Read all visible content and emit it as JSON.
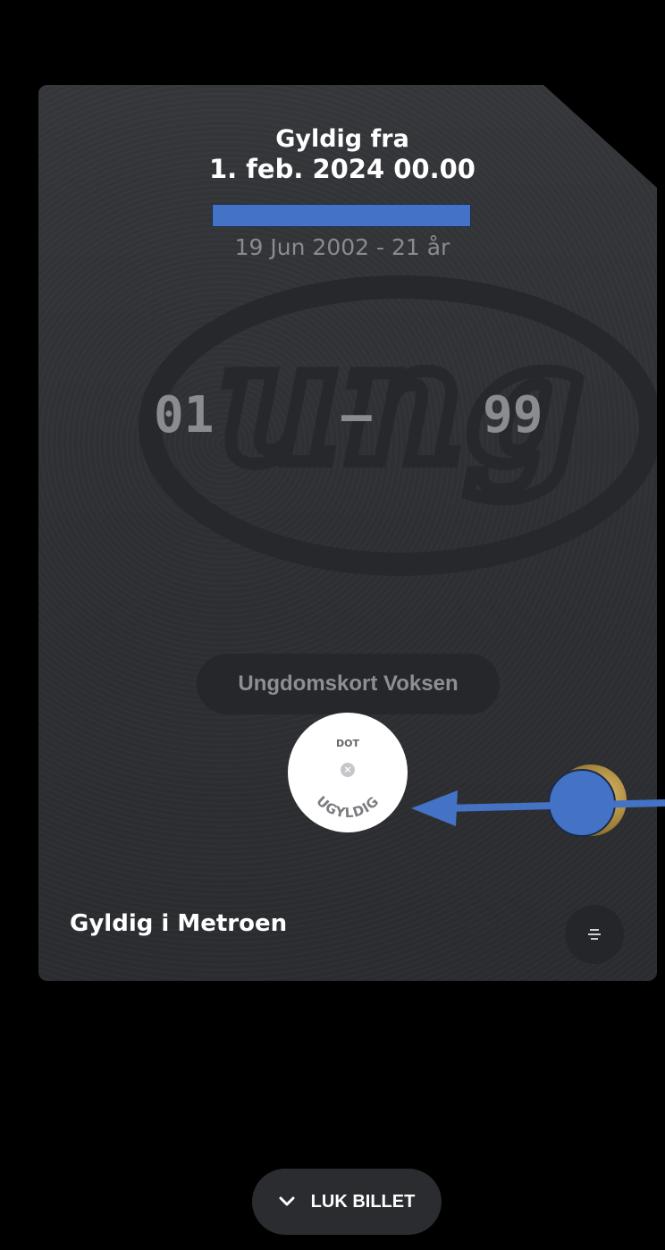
{
  "ticket": {
    "valid_from_label": "Gyldig fra",
    "valid_from_date": "1. feb. 2024 00.00",
    "birth_info": "19 Jun 2002 - 21 år",
    "logo_text": "ung",
    "zones": {
      "start": "01",
      "separator": "—",
      "end": "99"
    },
    "ticket_type": "Ungdomskort Voksen",
    "dot_badge": {
      "label": "DOT",
      "status": "UGYLDIG",
      "icon": "x-circle-icon"
    },
    "valid_in": "Gyldig i Metroen",
    "menu_icon": "menu-lines-icon"
  },
  "footer": {
    "close_label": "LUK BILLET",
    "close_icon": "chevron-down-icon"
  },
  "colors": {
    "background": "#000000",
    "card": "#2e3034",
    "redaction": "#4472c4",
    "annotation_arrow": "#4472c4",
    "text_primary": "#ffffff",
    "text_muted": "#8b8c8f"
  }
}
